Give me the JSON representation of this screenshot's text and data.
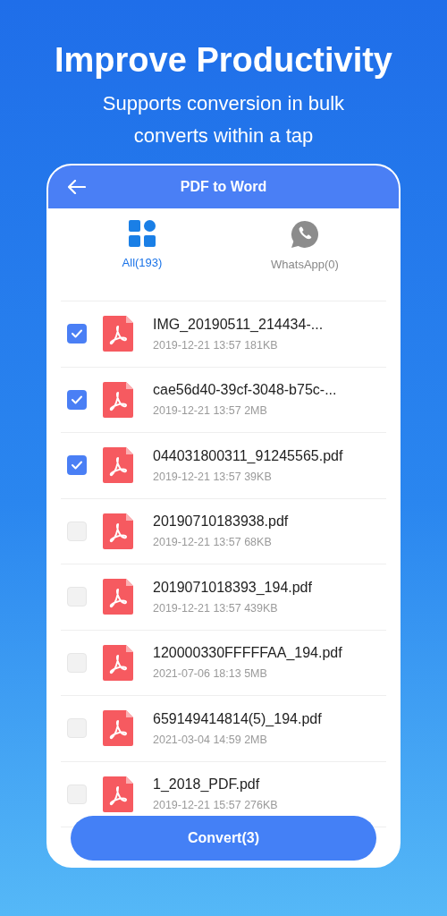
{
  "headline": "Improve Productivity",
  "subtitle_lines": [
    "Supports conversion in bulk",
    "converts within a tap"
  ],
  "app_bar": {
    "title": "PDF to Word"
  },
  "tabs": [
    {
      "label": "All(193)",
      "kind": "all",
      "selected": true
    },
    {
      "label": "WhatsApp(0)",
      "kind": "whatsapp",
      "selected": false
    }
  ],
  "files": [
    {
      "name": "IMG_20190511_214434-...",
      "meta": "2019-12-21 13:57 181KB",
      "checked": true
    },
    {
      "name": "cae56d40-39cf-3048-b75c-...",
      "meta": "2019-12-21 13:57 2MB",
      "checked": true
    },
    {
      "name": "044031800311_91245565.pdf",
      "meta": "2019-12-21 13:57 39KB",
      "checked": true
    },
    {
      "name": "20190710183938.pdf",
      "meta": "2019-12-21 13:57 68KB",
      "checked": false
    },
    {
      "name": "2019071018393_194.pdf",
      "meta": "2019-12-21 13:57 439KB",
      "checked": false
    },
    {
      "name": "120000330FFFFFAA_194.pdf",
      "meta": "2021-07-06 18:13 5MB",
      "checked": false
    },
    {
      "name": "659149414814(5)_194.pdf",
      "meta": "2021-03-04 14:59 2MB",
      "checked": false
    },
    {
      "name": "1_2018_PDF.pdf",
      "meta": "2019-12-21 15:57 276KB",
      "checked": false
    }
  ],
  "convert_button": "Convert(3)"
}
